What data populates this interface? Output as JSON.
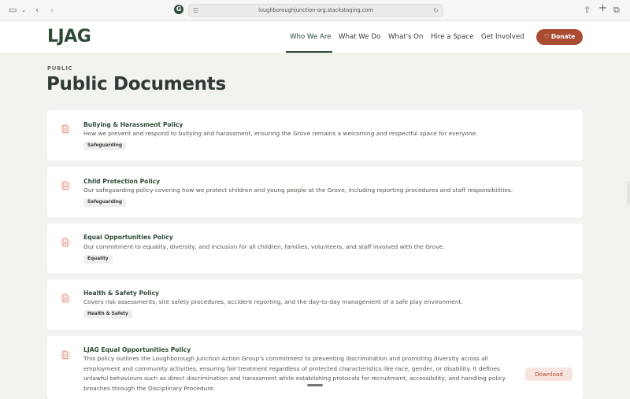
{
  "browser": {
    "url": "loughboroughjunction-org.stackstaging.com",
    "favicon_letter": "G"
  },
  "header": {
    "logo": "LJAG",
    "nav": [
      {
        "label": "Who We Are"
      },
      {
        "label": "What We Do"
      },
      {
        "label": "What's On"
      },
      {
        "label": "Hire a Space"
      },
      {
        "label": "Get Involved"
      }
    ],
    "donate_label": "♡ Donate"
  },
  "page": {
    "eyebrow": "PUBLIC",
    "title": "Public Documents"
  },
  "documents": [
    {
      "title": "Bullying & Harassment Policy",
      "description": "How we prevent and respond to bullying and harassment, ensuring the Grove remains a welcoming and respectful space for everyone.",
      "tag": "Safeguarding"
    },
    {
      "title": "Child Protection Policy",
      "description": "Our safeguarding policy covering how we protect children and young people at the Grove, including reporting procedures and staff responsibilities.",
      "tag": "Safeguarding"
    },
    {
      "title": "Equal Opportunities Policy",
      "description": "Our commitment to equality, diversity, and inclusion for all children, families, volunteers, and staff involved with the Grove.",
      "tag": "Equality"
    },
    {
      "title": "Health & Safety Policy",
      "description": "Covers risk assessments, site safety procedures, accident reporting, and the day-to-day management of a safe play environment.",
      "tag": "Health & Safety"
    },
    {
      "title": "LJAG Equal Opportunities Policy",
      "description": "This policy outlines the Loughborough Junction Action Group's commitment to preventing discrimination and promoting diversity across all employment and community activities, ensuring fair treatment regardless of protected characteristics like race, gender, or disability. It defines unlawful behaviours such as direct discrimination and harassment while establishing protocols for recruitment, accessibility, and handling policy breaches through the Disciplinary Procedure.",
      "download_label": "Download"
    }
  ]
}
